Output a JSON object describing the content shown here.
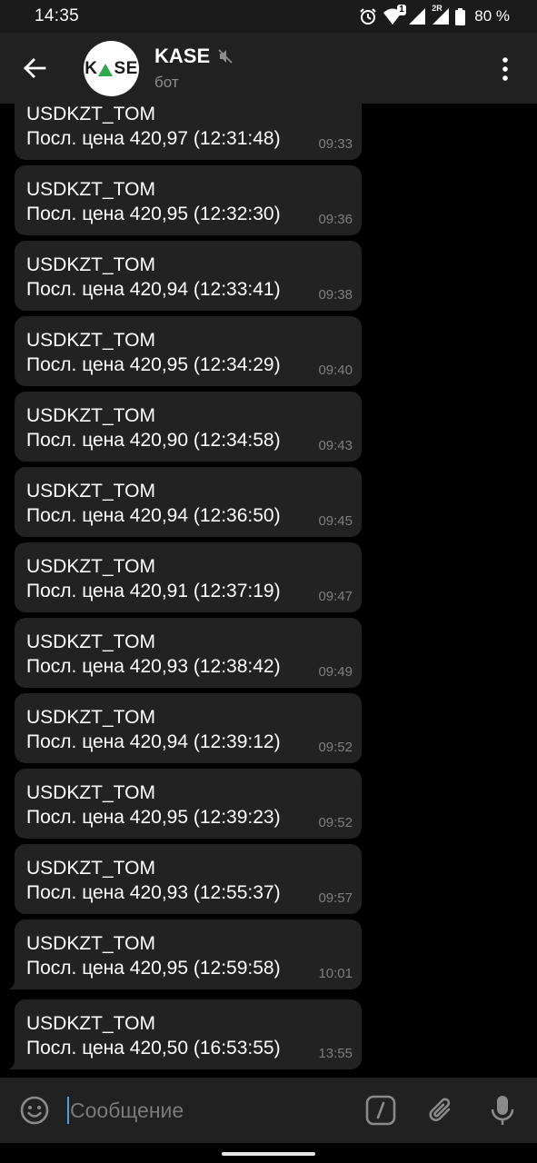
{
  "status_bar": {
    "time": "14:35",
    "notification_badge": "1",
    "roaming_label": "2R",
    "battery": "80 %",
    "icons": [
      "alarm-icon",
      "wifi-icon",
      "signal-icon",
      "signal-roaming-icon",
      "battery-icon"
    ]
  },
  "header": {
    "title": "KASE",
    "subtitle": "бот",
    "avatar_text_left": "K",
    "avatar_text_right": "SE",
    "muted": true,
    "avatar_accent": "#2fa84f"
  },
  "messages": [
    {
      "ticker": "USDKZT_TOM",
      "price": "Посл. цена 420,97 (12:31:48)",
      "time": "09:33"
    },
    {
      "ticker": "USDKZT_TOM",
      "price": "Посл. цена 420,95 (12:32:30)",
      "time": "09:36"
    },
    {
      "ticker": "USDKZT_TOM",
      "price": "Посл. цена 420,94 (12:33:41)",
      "time": "09:38"
    },
    {
      "ticker": "USDKZT_TOM",
      "price": "Посл. цена 420,95 (12:34:29)",
      "time": "09:40"
    },
    {
      "ticker": "USDKZT_TOM",
      "price": "Посл. цена 420,90 (12:34:58)",
      "time": "09:43"
    },
    {
      "ticker": "USDKZT_TOM",
      "price": "Посл. цена 420,94 (12:36:50)",
      "time": "09:45"
    },
    {
      "ticker": "USDKZT_TOM",
      "price": "Посл. цена 420,91 (12:37:19)",
      "time": "09:47"
    },
    {
      "ticker": "USDKZT_TOM",
      "price": "Посл. цена 420,93 (12:38:42)",
      "time": "09:49"
    },
    {
      "ticker": "USDKZT_TOM",
      "price": "Посл. цена 420,94 (12:39:12)",
      "time": "09:52"
    },
    {
      "ticker": "USDKZT_TOM",
      "price": "Посл. цена 420,95 (12:39:23)",
      "time": "09:52"
    },
    {
      "ticker": "USDKZT_TOM",
      "price": "Посл. цена 420,93 (12:55:37)",
      "time": "09:57"
    },
    {
      "ticker": "USDKZT_TOM",
      "price": "Посл. цена 420,95 (12:59:58)",
      "time": "10:01"
    },
    {
      "ticker": "USDKZT_TOM",
      "price": "Посл. цена 420,50 (16:53:55)",
      "time": "13:55"
    }
  ],
  "composer": {
    "placeholder": "Сообщение",
    "value": ""
  },
  "colors": {
    "background": "#000000",
    "bubble": "#222222",
    "header": "#212121",
    "accent": "#4e9de5"
  }
}
